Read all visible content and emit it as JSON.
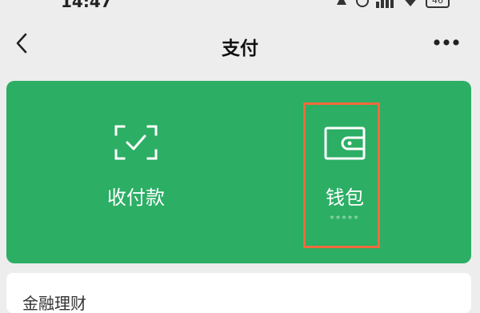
{
  "status_bar": {
    "time": "14:47",
    "battery_label": "46"
  },
  "nav": {
    "title": "支付",
    "back_icon": "chevron-left-icon",
    "more_icon": "more-horizontal-icon"
  },
  "pay_card": {
    "background": "#2cae65",
    "items": [
      {
        "label": "收付款",
        "icon": "scan-check-icon"
      },
      {
        "label": "钱包",
        "icon": "wallet-icon",
        "balance_masked": "*****"
      }
    ]
  },
  "highlight": {
    "color": "#f26a3c"
  },
  "bottom_card": {
    "label": "金融理财"
  }
}
